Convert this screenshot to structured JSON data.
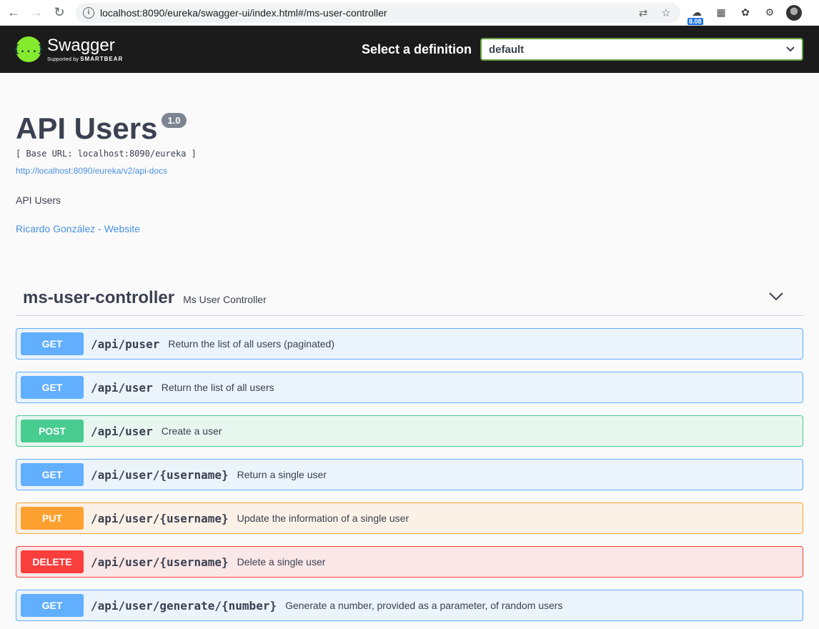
{
  "browser": {
    "url": "localhost:8090/eureka/swagger-ui/index.html#/ms-user-controller",
    "extension_badge": "8.08"
  },
  "topbar": {
    "logo_name": "Swagger",
    "logo_supported_by": "Supported by",
    "logo_brand": "SMARTBEAR",
    "logo_glyph": "{...}",
    "definition_label": "Select a definition",
    "definition_value": "default"
  },
  "info": {
    "title": "API Users",
    "version": "1.0",
    "base_url": "[ Base URL: localhost:8090/eureka ]",
    "docs_link": "http://localhost:8090/eureka/v2/api-docs",
    "description": "API Users",
    "website": "Ricardo González - Website"
  },
  "tag": {
    "name": "ms-user-controller",
    "description": "Ms User Controller"
  },
  "operations": [
    {
      "method": "GET",
      "path": "/api/puser",
      "summary": "Return the list of all users (paginated)"
    },
    {
      "method": "GET",
      "path": "/api/user",
      "summary": "Return the list of all users"
    },
    {
      "method": "POST",
      "path": "/api/user",
      "summary": "Create a user"
    },
    {
      "method": "GET",
      "path": "/api/user/{username}",
      "summary": "Return a single user"
    },
    {
      "method": "PUT",
      "path": "/api/user/{username}",
      "summary": "Update the information of a single user"
    },
    {
      "method": "DELETE",
      "path": "/api/user/{username}",
      "summary": "Delete a single user"
    },
    {
      "method": "GET",
      "path": "/api/user/generate/{number}",
      "summary": "Generate a number, provided as a parameter, of random users"
    }
  ],
  "colors": {
    "get": "#61affe",
    "post": "#49cc90",
    "put": "#fca130",
    "delete": "#f93e3e",
    "swagger_green": "#85ea2d",
    "link": "#4990e2"
  }
}
